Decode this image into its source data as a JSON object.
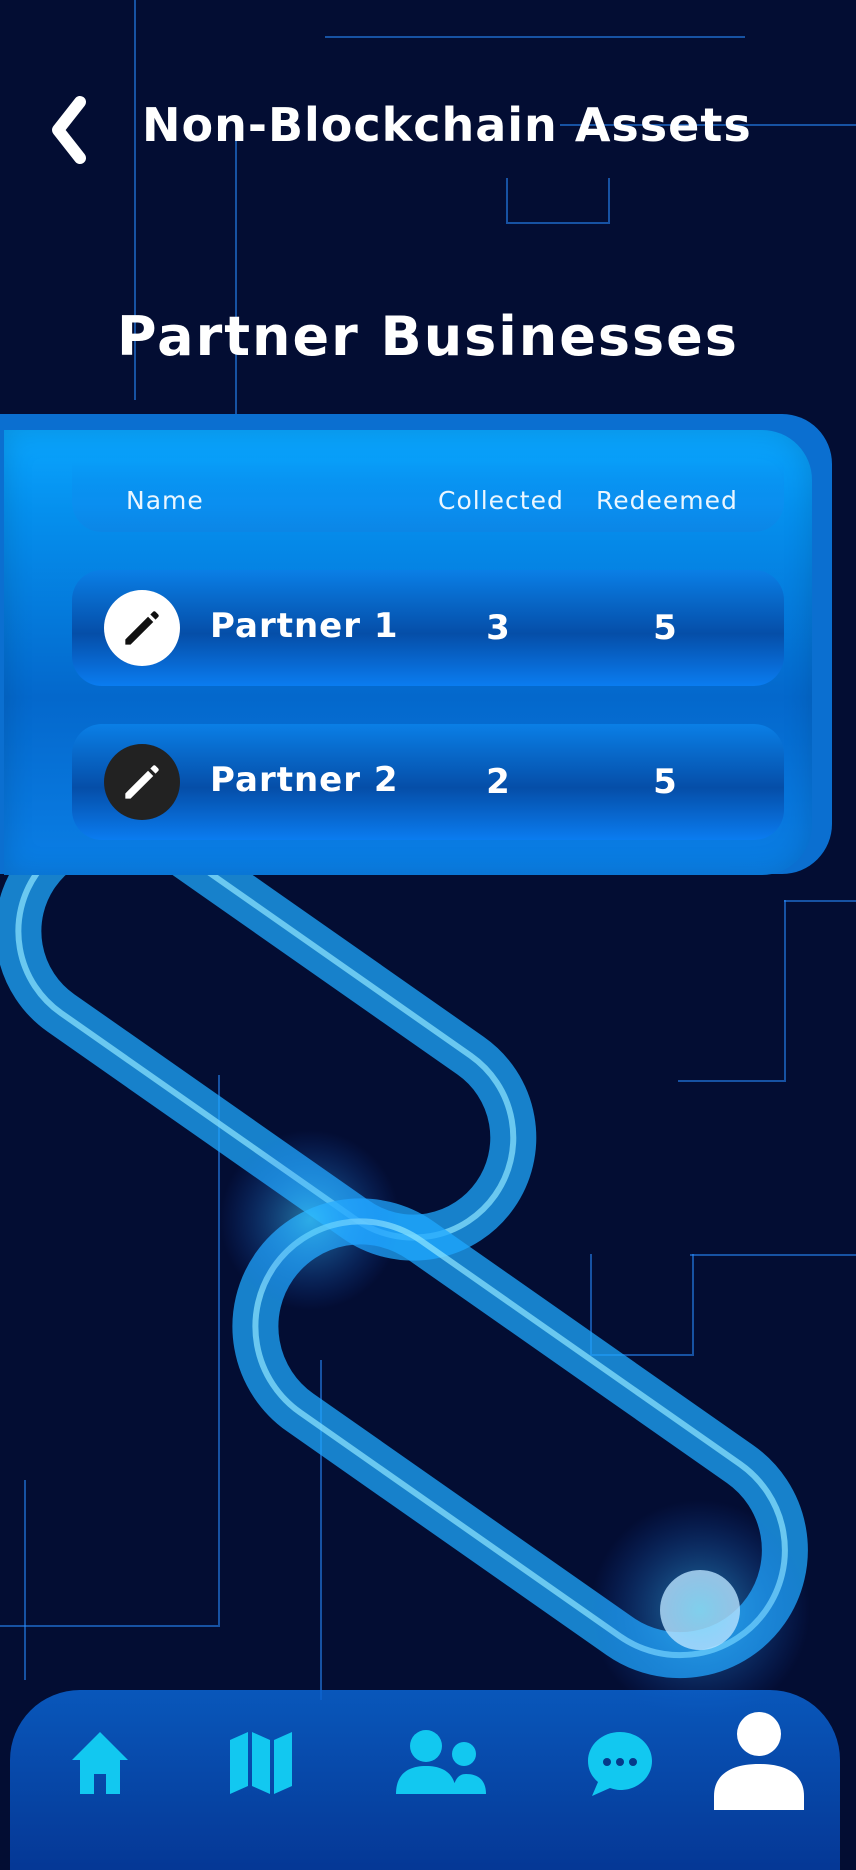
{
  "header": {
    "title": "Non-Blockchain Assets"
  },
  "section": {
    "title": "Partner Businesses"
  },
  "table": {
    "columns": [
      "Name",
      "Collected",
      "Redeemed"
    ],
    "rows": [
      {
        "name": "Partner 1",
        "collected": "3",
        "redeemed": "5",
        "edit_style": "light"
      },
      {
        "name": "Partner 2",
        "collected": "2",
        "redeemed": "5",
        "edit_style": "dark"
      }
    ]
  },
  "nav": {
    "items": [
      {
        "icon": "home-icon"
      },
      {
        "icon": "map-icon"
      },
      {
        "icon": "friends-icon"
      },
      {
        "icon": "chat-icon"
      },
      {
        "icon": "profile-icon",
        "active": true
      }
    ]
  },
  "colors": {
    "background": "#030d33",
    "panel": "#0590ee",
    "nav_icon": "#12c8f0",
    "active_icon": "#ffffff"
  }
}
